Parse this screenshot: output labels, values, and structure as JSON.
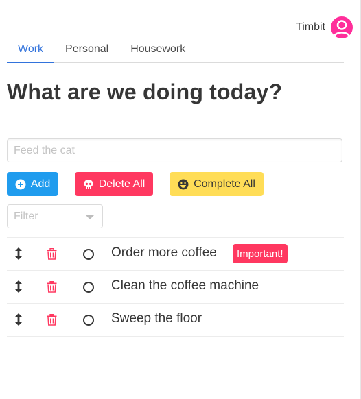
{
  "user": {
    "name": "Timbit"
  },
  "tabs": [
    {
      "label": "Work",
      "active": true
    },
    {
      "label": "Personal",
      "active": false
    },
    {
      "label": "Housework",
      "active": false
    }
  ],
  "page_title": "What are we doing today?",
  "new_task": {
    "placeholder": "Feed the cat",
    "value": ""
  },
  "buttons": {
    "add": {
      "label": "Add",
      "icon": "plus-circle-icon"
    },
    "delete_all": {
      "label": "Delete All",
      "icon": "skull-icon"
    },
    "complete_all": {
      "label": "Complete All",
      "icon": "grin-icon"
    }
  },
  "filter": {
    "placeholder": "Filter"
  },
  "tasks": [
    {
      "text": "Order more coffee",
      "tag": "Important!",
      "completed": false
    },
    {
      "text": "Clean the coffee machine",
      "tag": "",
      "completed": false
    },
    {
      "text": "Sweep the floor",
      "tag": "",
      "completed": false
    }
  ],
  "colors": {
    "accent": "#3273dc",
    "info": "#209cee",
    "danger": "#ff3860",
    "warning": "#ffdd57",
    "avatar": "#ff2e9a"
  }
}
